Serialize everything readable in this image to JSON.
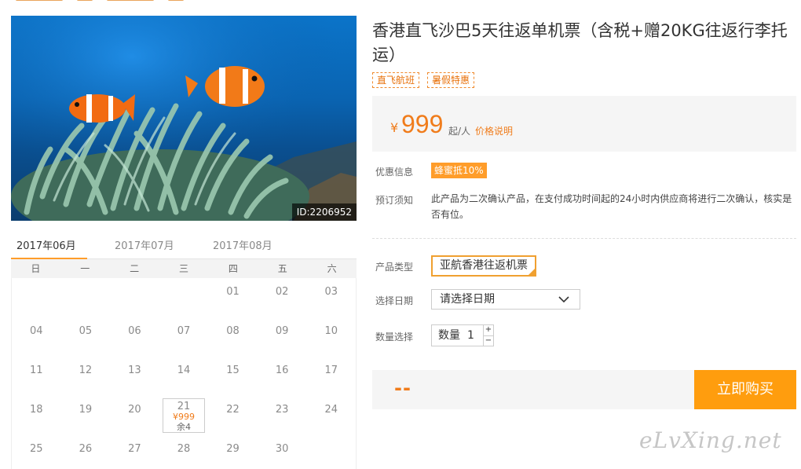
{
  "product": {
    "image_id": "ID:2206952",
    "title": "香港直飞沙巴5天往返单机票（含税+赠20KG往返行李托运）",
    "tags": [
      "直飞航班",
      "暑假特惠"
    ]
  },
  "price": {
    "currency": "¥",
    "amount": "999",
    "unit": "起/人",
    "explain_link": "价格说明"
  },
  "promo": {
    "label": "优惠信息",
    "badge": "蜂蜜抵10%"
  },
  "booking_notice": {
    "label": "预订须知",
    "text": "此产品为二次确认产品，在支付成功时间起的24小时内供应商将进行二次确认，核实是否有位。"
  },
  "options": {
    "product_type_label": "产品类型",
    "product_type_value": "亚航香港往返机票",
    "date_label": "选择日期",
    "date_placeholder": "请选择日期",
    "quantity_label": "数量选择",
    "quantity_prefix": "数量",
    "quantity_value": "1",
    "plus": "+",
    "minus": "−"
  },
  "buy": {
    "total": "--",
    "button_label": "立即购买"
  },
  "calendar": {
    "months": [
      "2017年06月",
      "2017年07月",
      "2017年08月"
    ],
    "active_month": 0,
    "weekdays": [
      "日",
      "一",
      "二",
      "三",
      "四",
      "五",
      "六"
    ],
    "cells": [
      "",
      "",
      "",
      "",
      "01",
      "02",
      "03",
      "04",
      "05",
      "06",
      "07",
      "08",
      "09",
      "10",
      "11",
      "12",
      "13",
      "14",
      "15",
      "16",
      "17",
      "18",
      "19",
      "20",
      "21",
      "22",
      "23",
      "24",
      "25",
      "26",
      "27",
      "28",
      "29",
      "30",
      ""
    ],
    "available": {
      "21": {
        "price": "¥999",
        "stock": "余4"
      }
    }
  },
  "watermark": "eLvXing.net",
  "colors": {
    "accent": "#ff9d2a",
    "price": "#f07c1b"
  }
}
